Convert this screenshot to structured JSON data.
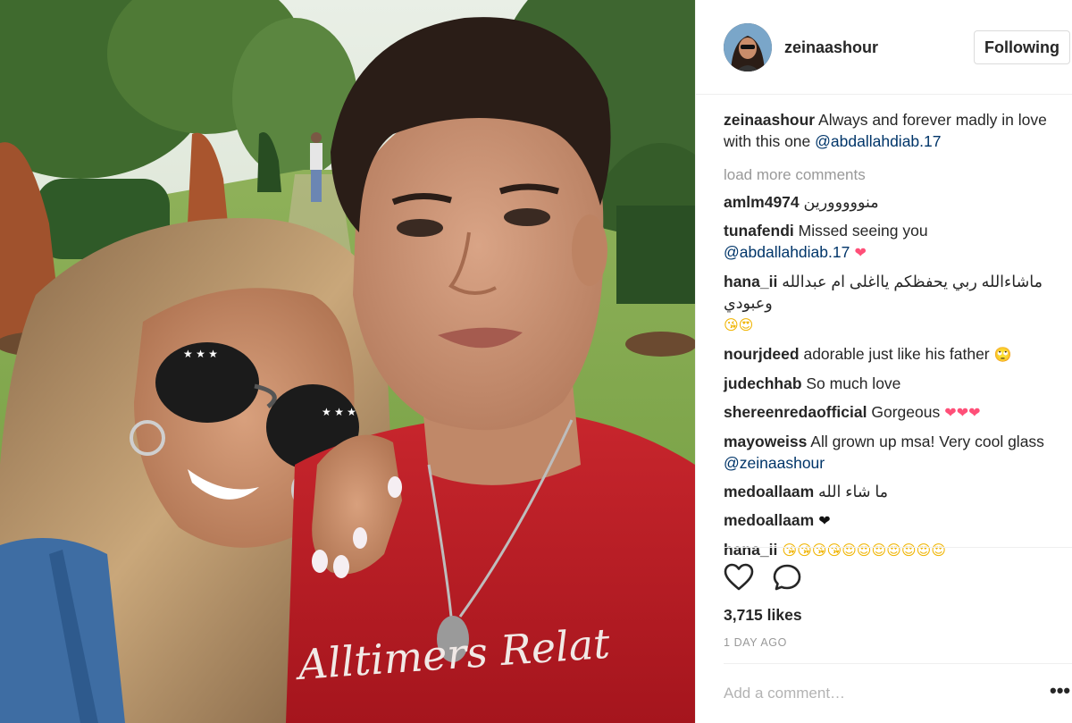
{
  "post": {
    "author": "zeinaashour",
    "follow_label": "Following",
    "caption": {
      "username": "zeinaashour",
      "text": " Always and forever madly in love with this one ",
      "mention": "@abdallahdiab.17"
    },
    "load_more_label": "load more comments",
    "comments": [
      {
        "username": "amlm4974",
        "text": " منووووورين"
      },
      {
        "username": "tunafendi",
        "text": " Missed seeing you",
        "mention": "@abdallahdiab.17",
        "emoji": " ❤"
      },
      {
        "username": "hana_ii",
        "text": " ماشاءالله ربي يحفظكم يااغلى ام عبدالله وعبودي",
        "emoji": "😘😍"
      },
      {
        "username": "nourjdeed",
        "text": " adorable just like his father",
        "emoji": " 🙄"
      },
      {
        "username": "judechhab",
        "text": " So much love"
      },
      {
        "username": "shereenredaofficial",
        "text": " Gorgeous",
        "emoji": " ❤❤❤"
      },
      {
        "username": "mayoweiss",
        "text": " All grown up msa! Very cool glass",
        "mention": "@zeinaashour"
      },
      {
        "username": "medoallaam",
        "text": " ما شاء الله"
      },
      {
        "username": "medoallaam",
        "text": "",
        "emoji": " ❤"
      },
      {
        "username": "hana_ii",
        "text": "",
        "emoji": " 😘😘😘😘😍😍😍😍😍😍😍"
      }
    ],
    "likes": "3,715 likes",
    "timestamp": "1 DAY AGO",
    "add_comment_placeholder": "Add a comment…",
    "more_options": "•••",
    "photo_shirt_text": "Alltimers Relat"
  },
  "icons": {
    "like": "heart-outline-icon",
    "comment": "speech-bubble-icon",
    "more": "ellipsis-icon"
  },
  "colors": {
    "mention": "#003569",
    "muted": "#999999",
    "border": "#dbdbdb",
    "heart": "#ff4f78"
  }
}
